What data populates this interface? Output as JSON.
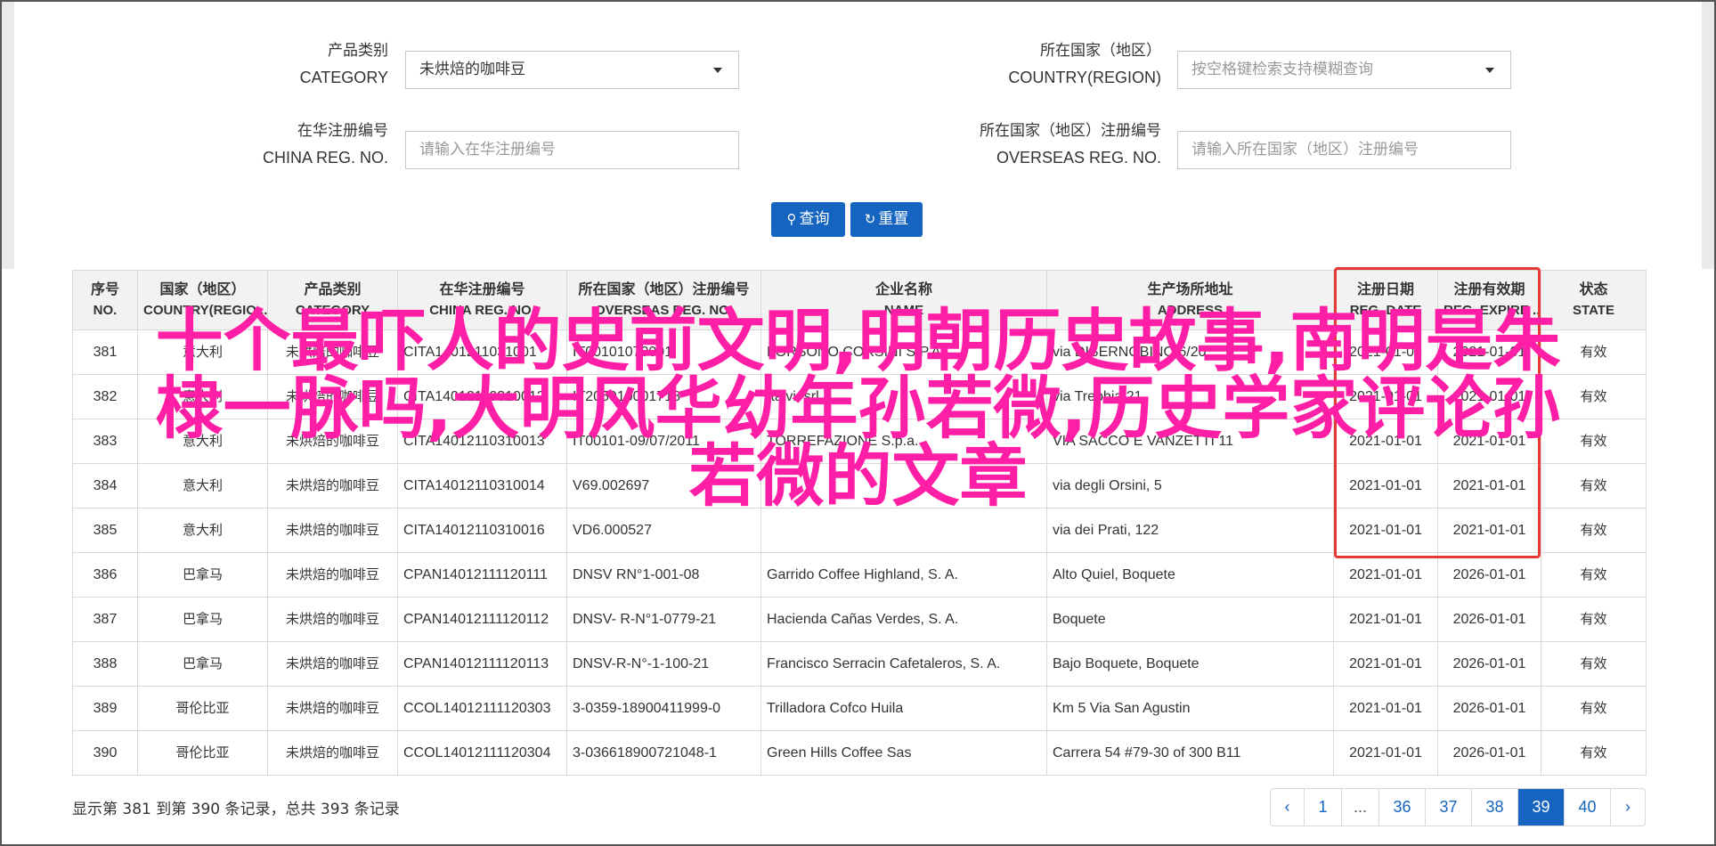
{
  "form": {
    "category_label_cn": "产品类别",
    "category_label_en": "CATEGORY",
    "category_value": "未烘焙的咖啡豆",
    "country_label_cn": "所在国家（地区）",
    "country_label_en": "COUNTRY(REGION)",
    "country_placeholder": "按空格键检索支持模糊查询",
    "china_reg_label_cn": "在华注册编号",
    "china_reg_label_en": "CHINA REG. NO.",
    "china_reg_placeholder": "请输入在华注册编号",
    "overseas_reg_label_cn": "所在国家（地区）注册编号",
    "overseas_reg_label_en": "OVERSEAS REG. NO.",
    "overseas_reg_placeholder": "请输入所在国家（地区）注册编号",
    "search_label": "查询",
    "reset_label": "重置"
  },
  "table": {
    "headers": [
      {
        "cn": "序号",
        "en": "NO."
      },
      {
        "cn": "国家（地区）",
        "en": "COUNTRY(REGIO..."
      },
      {
        "cn": "产品类别",
        "en": "CATEGORY"
      },
      {
        "cn": "在华注册编号",
        "en": "CHINA REG. NO."
      },
      {
        "cn": "所在国家（地区）注册编号",
        "en": "OVERSEAS REG. NO."
      },
      {
        "cn": "企业名称",
        "en": "NAME"
      },
      {
        "cn": "生产场所地址",
        "en": "ADDRESS"
      },
      {
        "cn": "注册日期",
        "en": "REG. DATE"
      },
      {
        "cn": "注册有效期",
        "en": "REG. EXPIRE ..."
      },
      {
        "cn": "状态",
        "en": "STATE"
      }
    ],
    "rows": [
      {
        "no": "381",
        "country": "意大利",
        "category": "未烘焙的咖啡豆",
        "china_reg": "CITA1401211031001",
        "overseas_reg": "IT00101070001",
        "name": "FORSONO CORSINI S.P.A.",
        "address": "via DISERNOBINO 6/20",
        "reg_date": "2021-01-01",
        "expire": "2021-01-01",
        "state": "有效"
      },
      {
        "no": "382",
        "country": "意大利",
        "category": "未烘焙的咖啡豆",
        "china_reg": "CITA14012110310012",
        "overseas_reg": "IT205910001718",
        "name": "Italvi, srl",
        "address": "via Trebbia 21",
        "reg_date": "2021-01-01",
        "expire": "2021-01-01",
        "state": "有效"
      },
      {
        "no": "383",
        "country": "意大利",
        "category": "未烘焙的咖啡豆",
        "china_reg": "CITA14012110310013",
        "overseas_reg": "IT00101-09/07/2011",
        "name": "TORREFAZIONE S.p.a.",
        "address": "VIA SACCO E VANZETTI 11",
        "reg_date": "2021-01-01",
        "expire": "2021-01-01",
        "state": "有效"
      },
      {
        "no": "384",
        "country": "意大利",
        "category": "未烘焙的咖啡豆",
        "china_reg": "CITA14012110310014",
        "overseas_reg": "V69.002697",
        "name": "",
        "address": "via degli Orsini, 5",
        "reg_date": "2021-01-01",
        "expire": "2021-01-01",
        "state": "有效"
      },
      {
        "no": "385",
        "country": "意大利",
        "category": "未烘焙的咖啡豆",
        "china_reg": "CITA14012110310016",
        "overseas_reg": "VD6.000527",
        "name": "",
        "address": "via dei Prati, 122",
        "reg_date": "2021-01-01",
        "expire": "2021-01-01",
        "state": "有效"
      },
      {
        "no": "386",
        "country": "巴拿马",
        "category": "未烘焙的咖啡豆",
        "china_reg": "CPAN14012111120111",
        "overseas_reg": "DNSV RN°1-001-08",
        "name": "Garrido Coffee Highland, S. A.",
        "address": "Alto Quiel, Boquete",
        "reg_date": "2021-01-01",
        "expire": "2026-01-01",
        "state": "有效"
      },
      {
        "no": "387",
        "country": "巴拿马",
        "category": "未烘焙的咖啡豆",
        "china_reg": "CPAN14012111120112",
        "overseas_reg": "DNSV- R-N°1-0779-21",
        "name": "Hacienda Cañas Verdes, S. A.",
        "address": "Boquete",
        "reg_date": "2021-01-01",
        "expire": "2026-01-01",
        "state": "有效"
      },
      {
        "no": "388",
        "country": "巴拿马",
        "category": "未烘焙的咖啡豆",
        "china_reg": "CPAN14012111120113",
        "overseas_reg": "DNSV-R-N°-1-100-21",
        "name": "Francisco Serracin Cafetaleros, S. A.",
        "address": "Bajo Boquete, Boquete",
        "reg_date": "2021-01-01",
        "expire": "2026-01-01",
        "state": "有效"
      },
      {
        "no": "389",
        "country": "哥伦比亚",
        "category": "未烘焙的咖啡豆",
        "china_reg": "CCOL14012111120303",
        "overseas_reg": "3-0359-18900411999-0",
        "name": "Trilladora Cofco Huila",
        "address": "Km 5 Via San Agustin",
        "reg_date": "2021-01-01",
        "expire": "2026-01-01",
        "state": "有效"
      },
      {
        "no": "390",
        "country": "哥伦比亚",
        "category": "未烘焙的咖啡豆",
        "china_reg": "CCOL14012111120304",
        "overseas_reg": "3-036618900721048-1",
        "name": "Green Hills Coffee Sas",
        "address": "Carrera 54 #79-30 of 300 B11",
        "reg_date": "2021-01-01",
        "expire": "2026-01-01",
        "state": "有效"
      }
    ]
  },
  "overlay": {
    "line1": "十个最吓人的史前文明,明朝历史故事,南明是朱",
    "line2": "棣一脉吗,大明风华幼年孙若微,历史学家评论孙",
    "line3": "若微的文章",
    "color": "#ff1fa6"
  },
  "summary": "显示第 381 到第 390 条记录，总共 393 条记录",
  "pagination": [
    "‹",
    "1",
    "...",
    "36",
    "37",
    "38",
    "39",
    "40",
    "›"
  ],
  "pagination_active": "39",
  "colors": {
    "accent": "#1565c0",
    "highlight": "#e53935"
  }
}
